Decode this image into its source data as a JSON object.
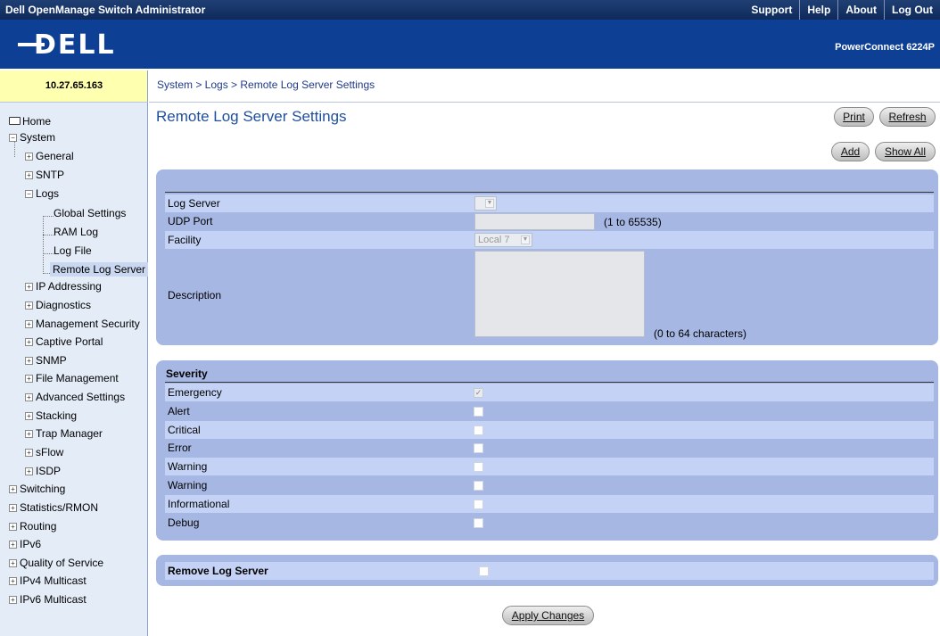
{
  "topbar": {
    "app_title": "Dell OpenManage Switch Administrator",
    "links": [
      "Support",
      "Help",
      "About",
      "Log Out"
    ]
  },
  "banner": {
    "logo": "DELL",
    "product": "PowerConnect 6224P"
  },
  "ip_address": "10.27.65.163",
  "breadcrumb": "System > Logs > Remote Log Server Settings",
  "nav": {
    "home": "Home",
    "system": "System",
    "general": "General",
    "sntp": "SNTP",
    "logs": "Logs",
    "global_settings": "Global Settings",
    "ram_log": "RAM Log",
    "log_file": "Log File",
    "remote_log_server": "Remote Log Server",
    "ip_addressing": "IP Addressing",
    "diagnostics": "Diagnostics",
    "management_security": "Management Security",
    "captive_portal": "Captive Portal",
    "snmp": "SNMP",
    "file_management": "File Management",
    "advanced_settings": "Advanced Settings",
    "stacking": "Stacking",
    "trap_manager": "Trap Manager",
    "sflow": "sFlow",
    "isdp": "ISDP",
    "switching": "Switching",
    "statistics_rmon": "Statistics/RMON",
    "routing": "Routing",
    "ipv6": "IPv6",
    "quality_of_service": "Quality of Service",
    "ipv4_multicast": "IPv4 Multicast",
    "ipv6_multicast": "IPv6 Multicast"
  },
  "page": {
    "title": "Remote Log Server Settings",
    "print_label": "Print",
    "refresh_label": "Refresh",
    "add_label": "Add",
    "show_all_label": "Show All"
  },
  "form": {
    "log_server_label": "Log Server",
    "log_server_value": "",
    "udp_port_label": "UDP Port",
    "udp_port_value": "",
    "udp_port_range": "(1 to 65535)",
    "facility_label": "Facility",
    "facility_value": "Local 7",
    "description_label": "Description",
    "description_value": "",
    "description_range": "(0 to 64 characters)"
  },
  "severity": {
    "header": "Severity",
    "levels": [
      {
        "label": "Emergency",
        "checked": true,
        "disabled": true
      },
      {
        "label": "Alert",
        "checked": false,
        "disabled": false
      },
      {
        "label": "Critical",
        "checked": false,
        "disabled": false
      },
      {
        "label": "Error",
        "checked": false,
        "disabled": false
      },
      {
        "label": "Warning",
        "checked": false,
        "disabled": false
      },
      {
        "label": "Warning",
        "checked": false,
        "disabled": false
      },
      {
        "label": "Informational",
        "checked": false,
        "disabled": false
      },
      {
        "label": "Debug",
        "checked": false,
        "disabled": false
      }
    ]
  },
  "remove": {
    "label": "Remove Log Server",
    "checked": false
  },
  "apply_label": "Apply Changes"
}
